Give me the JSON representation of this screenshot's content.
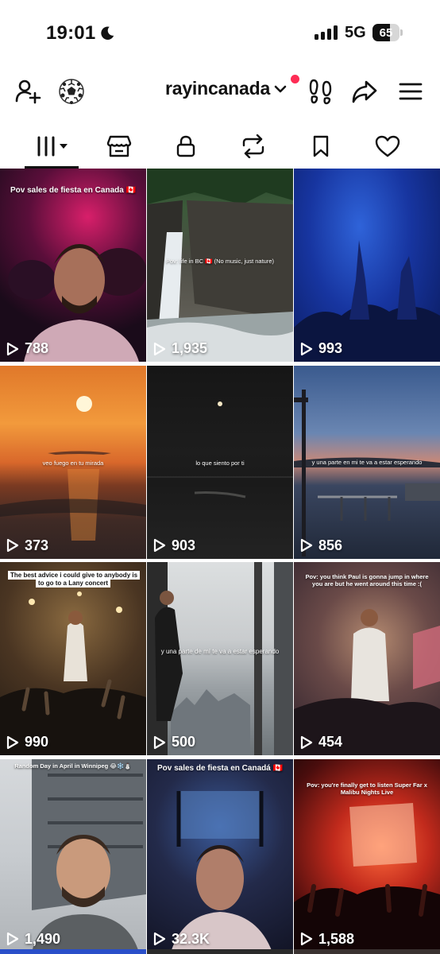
{
  "status_bar": {
    "time": "19:01",
    "network": "5G",
    "battery_level": "65",
    "battery_fraction": 0.65,
    "moon_icon": "moon-icon"
  },
  "header": {
    "username": "rayincanada",
    "left_icons": [
      "add-user-icon",
      "soccer-ball-icon"
    ],
    "right_icons": [
      "footprints-icon",
      "share-icon",
      "menu-icon"
    ],
    "notification_color": "#fe2c55"
  },
  "tabs": [
    {
      "icon": "videos-grid-icon",
      "active": true
    },
    {
      "icon": "shop-icon",
      "active": false
    },
    {
      "icon": "lock-icon",
      "active": false
    },
    {
      "icon": "repost-icon",
      "active": false
    },
    {
      "icon": "bookmark-icon",
      "active": false
    },
    {
      "icon": "heart-icon",
      "active": false
    }
  ],
  "videos": [
    {
      "views": "788",
      "caption": "Pov sales de fiesta en Canada 🇨🇦"
    },
    {
      "views": "1,935",
      "caption": "Pov: life in BC 🇨🇦 (No music, just nature)"
    },
    {
      "views": "993",
      "caption": ""
    },
    {
      "views": "373",
      "caption": "veo fuego en tu mirada"
    },
    {
      "views": "903",
      "caption": "lo que siento por ti"
    },
    {
      "views": "856",
      "caption": "y una parte en mi te va a estar esperando"
    },
    {
      "views": "990",
      "caption": "The best advice i could give to anybody is to go to a Lany concert"
    },
    {
      "views": "500",
      "caption": "y una parte de mí te va a estar esperando"
    },
    {
      "views": "454",
      "caption": "Pov: you think Paul is gonna jump in where you are but he went around this time :("
    },
    {
      "views": "1,490",
      "caption": "Random Day in April in Winnipeg 😂❄️⛄"
    },
    {
      "views": "32.3K",
      "caption": "Pov sales de fiesta en Canadá 🇨🇦"
    },
    {
      "views": "1,588",
      "caption": "Pov: you're finally get to listen Super Far x Malibu Nights Live"
    }
  ],
  "colors": {
    "text": "#111111",
    "accent": "#fe2c55"
  }
}
